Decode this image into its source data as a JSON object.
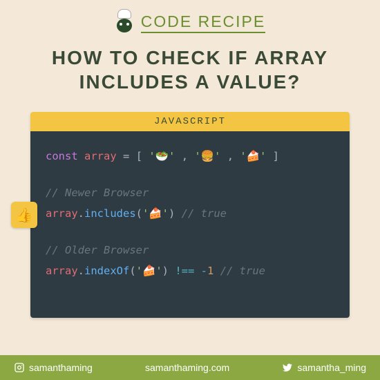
{
  "brand": {
    "title": "CODE RECIPE"
  },
  "title": {
    "line1": "HOW TO CHECK IF ARRAY",
    "line2": "INCLUDES A VALUE?"
  },
  "code": {
    "lang_label": "JAVASCRIPT",
    "decl_kw": "const",
    "decl_var": "array",
    "decl_eq": " = ",
    "decl_open": "[",
    "decl_close": "]",
    "item1": "'🥗'",
    "item2": "'🍔'",
    "item3": "'🍰'",
    "comma": ", ",
    "newer_comment": "// Newer Browser",
    "includes_var": "array",
    "includes_dot": ".",
    "includes_fn": "includes",
    "includes_open": "(",
    "includes_arg": "'🍰'",
    "includes_close": ")",
    "includes_result": " // true",
    "older_comment": "// Older Browser",
    "indexof_var": "array",
    "indexof_fn": "indexOf",
    "indexof_arg": "'🍰'",
    "indexof_op": " !== ",
    "indexof_neg": "-",
    "indexof_one": "1",
    "indexof_result": " // true"
  },
  "badge": {
    "thumb": "👍"
  },
  "footer": {
    "instagram": "samanthaming",
    "website": "samanthaming.com",
    "twitter": "samantha_ming"
  }
}
